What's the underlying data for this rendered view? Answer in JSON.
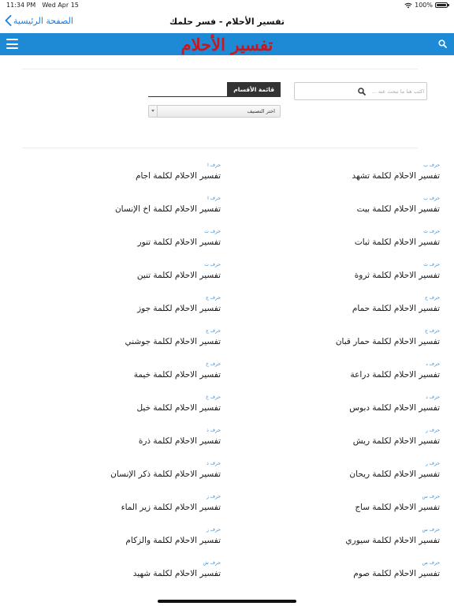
{
  "status_bar": {
    "time": "11:34 PM",
    "date": "Wed Apr 15",
    "battery": "100%"
  },
  "nav": {
    "back_label": "الصفحة الرئيسية",
    "title": "تفسير الأحلام - فسر حلمك"
  },
  "header": {
    "logo_text": "تفسير الأحلام",
    "accent_color": "#1e8ad6",
    "logo_color": "#c8181e"
  },
  "filters": {
    "search_placeholder": "اكتب هنا ما تبحث عنه ...",
    "sections_label": "قائمة الأقسام",
    "category_selected": "اختر التصنيف"
  },
  "entries": [
    [
      {
        "letter": "حرف ب",
        "title": "تفسير الاحلام لكلمة تشهد"
      },
      {
        "letter": "حرف ا",
        "title": "تفسير الاحلام لكلمة اجام"
      }
    ],
    [
      {
        "letter": "حرف ب",
        "title": "تفسير الاحلام لكلمة بيت"
      },
      {
        "letter": "حرف ا",
        "title": "تفسير الاحلام لكلمة اخ الإنسان"
      }
    ],
    [
      {
        "letter": "حرف ث",
        "title": "تفسير الاحلام لكلمة ثبات"
      },
      {
        "letter": "حرف ت",
        "title": "تفسير الاحلام لكلمة تنور"
      }
    ],
    [
      {
        "letter": "حرف ث",
        "title": "تفسير الاحلام لكلمة ثروة"
      },
      {
        "letter": "حرف ت",
        "title": "تفسير الاحلام لكلمة تنين"
      }
    ],
    [
      {
        "letter": "حرف ح",
        "title": "تفسير الاحلام لكلمة حمام"
      },
      {
        "letter": "حرف ج",
        "title": "تفسير الاحلام لكلمة جوز"
      }
    ],
    [
      {
        "letter": "حرف ح",
        "title": "تفسير الاحلام لكلمة حمار قبان"
      },
      {
        "letter": "حرف ج",
        "title": "تفسير الاحلام لكلمة جوشني"
      }
    ],
    [
      {
        "letter": "حرف د",
        "title": "تفسير الاحلام لكلمة دراعة"
      },
      {
        "letter": "حرف خ",
        "title": "تفسير الاحلام لكلمة خيمة"
      }
    ],
    [
      {
        "letter": "حرف د",
        "title": "تفسير الاحلام لكلمة دبوس"
      },
      {
        "letter": "حرف خ",
        "title": "تفسير الاحلام لكلمة خيل"
      }
    ],
    [
      {
        "letter": "حرف ر",
        "title": "تفسير الاحلام لكلمة ريش"
      },
      {
        "letter": "حرف ذ",
        "title": "تفسير الاحلام لكلمة ذرة"
      }
    ],
    [
      {
        "letter": "حرف ر",
        "title": "تفسير الاحلام لكلمة ريحان"
      },
      {
        "letter": "حرف ذ",
        "title": "تفسير الاحلام لكلمة ذكر الإنسان"
      }
    ],
    [
      {
        "letter": "حرف س",
        "title": "تفسير الاحلام لكلمة ساج"
      },
      {
        "letter": "حرف ز",
        "title": "تفسير الاحلام لكلمة زير الماء"
      }
    ],
    [
      {
        "letter": "حرف س",
        "title": "تفسير الاحلام لكلمة سيوري"
      },
      {
        "letter": "حرف ز",
        "title": "تفسير الاحلام لكلمة والزكام"
      }
    ],
    [
      {
        "letter": "حرف ص",
        "title": "تفسير الاحلام لكلمة صوم"
      },
      {
        "letter": "حرف ش",
        "title": "تفسير الاحلام لكلمة شهيد"
      }
    ]
  ]
}
